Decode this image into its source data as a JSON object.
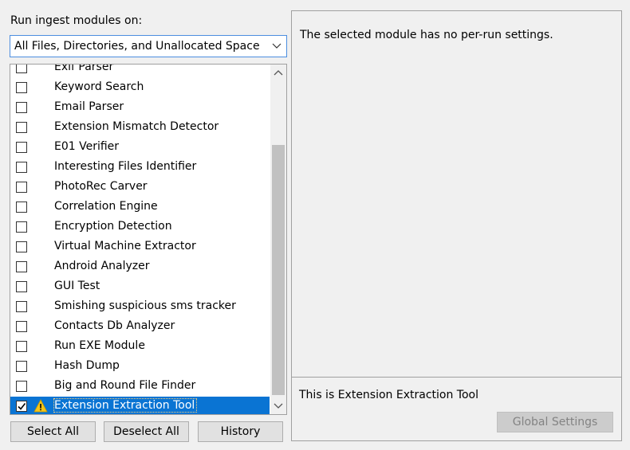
{
  "run_label": "Run ingest modules on:",
  "scope": {
    "selected": "All Files, Directories, and Unallocated Space"
  },
  "modules": [
    {
      "label": "Exif Parser",
      "checked": false,
      "warning": false,
      "selected": false
    },
    {
      "label": "Keyword Search",
      "checked": false,
      "warning": false,
      "selected": false
    },
    {
      "label": "Email Parser",
      "checked": false,
      "warning": false,
      "selected": false
    },
    {
      "label": "Extension Mismatch Detector",
      "checked": false,
      "warning": false,
      "selected": false
    },
    {
      "label": "E01 Verifier",
      "checked": false,
      "warning": false,
      "selected": false
    },
    {
      "label": "Interesting Files Identifier",
      "checked": false,
      "warning": false,
      "selected": false
    },
    {
      "label": "PhotoRec Carver",
      "checked": false,
      "warning": false,
      "selected": false
    },
    {
      "label": "Correlation Engine",
      "checked": false,
      "warning": false,
      "selected": false
    },
    {
      "label": "Encryption Detection",
      "checked": false,
      "warning": false,
      "selected": false
    },
    {
      "label": "Virtual Machine Extractor",
      "checked": false,
      "warning": false,
      "selected": false
    },
    {
      "label": "Android Analyzer",
      "checked": false,
      "warning": false,
      "selected": false
    },
    {
      "label": "GUI Test",
      "checked": false,
      "warning": false,
      "selected": false
    },
    {
      "label": "Smishing suspicious sms tracker",
      "checked": false,
      "warning": false,
      "selected": false
    },
    {
      "label": "Contacts Db Analyzer",
      "checked": false,
      "warning": false,
      "selected": false
    },
    {
      "label": "Run EXE Module",
      "checked": false,
      "warning": false,
      "selected": false
    },
    {
      "label": "Hash Dump",
      "checked": false,
      "warning": false,
      "selected": false
    },
    {
      "label": "Big and Round File Finder",
      "checked": false,
      "warning": false,
      "selected": false
    },
    {
      "label": "Extension Extraction Tool",
      "checked": true,
      "warning": true,
      "selected": true
    }
  ],
  "buttons": {
    "select_all": "Select All",
    "deselect_all": "Deselect All",
    "history": "History",
    "global_settings": "Global Settings"
  },
  "settings_panel": {
    "message": "The selected module has no per-run settings.",
    "description": "This is Extension Extraction Tool"
  },
  "colors": {
    "selection": "#0a74d3",
    "warning": "#f5c518",
    "focus_border": "#4c8ee0"
  },
  "icons": {
    "checkbox": "checkbox-icon",
    "warning": "warning-icon",
    "dropdown": "chevron-down-icon"
  }
}
